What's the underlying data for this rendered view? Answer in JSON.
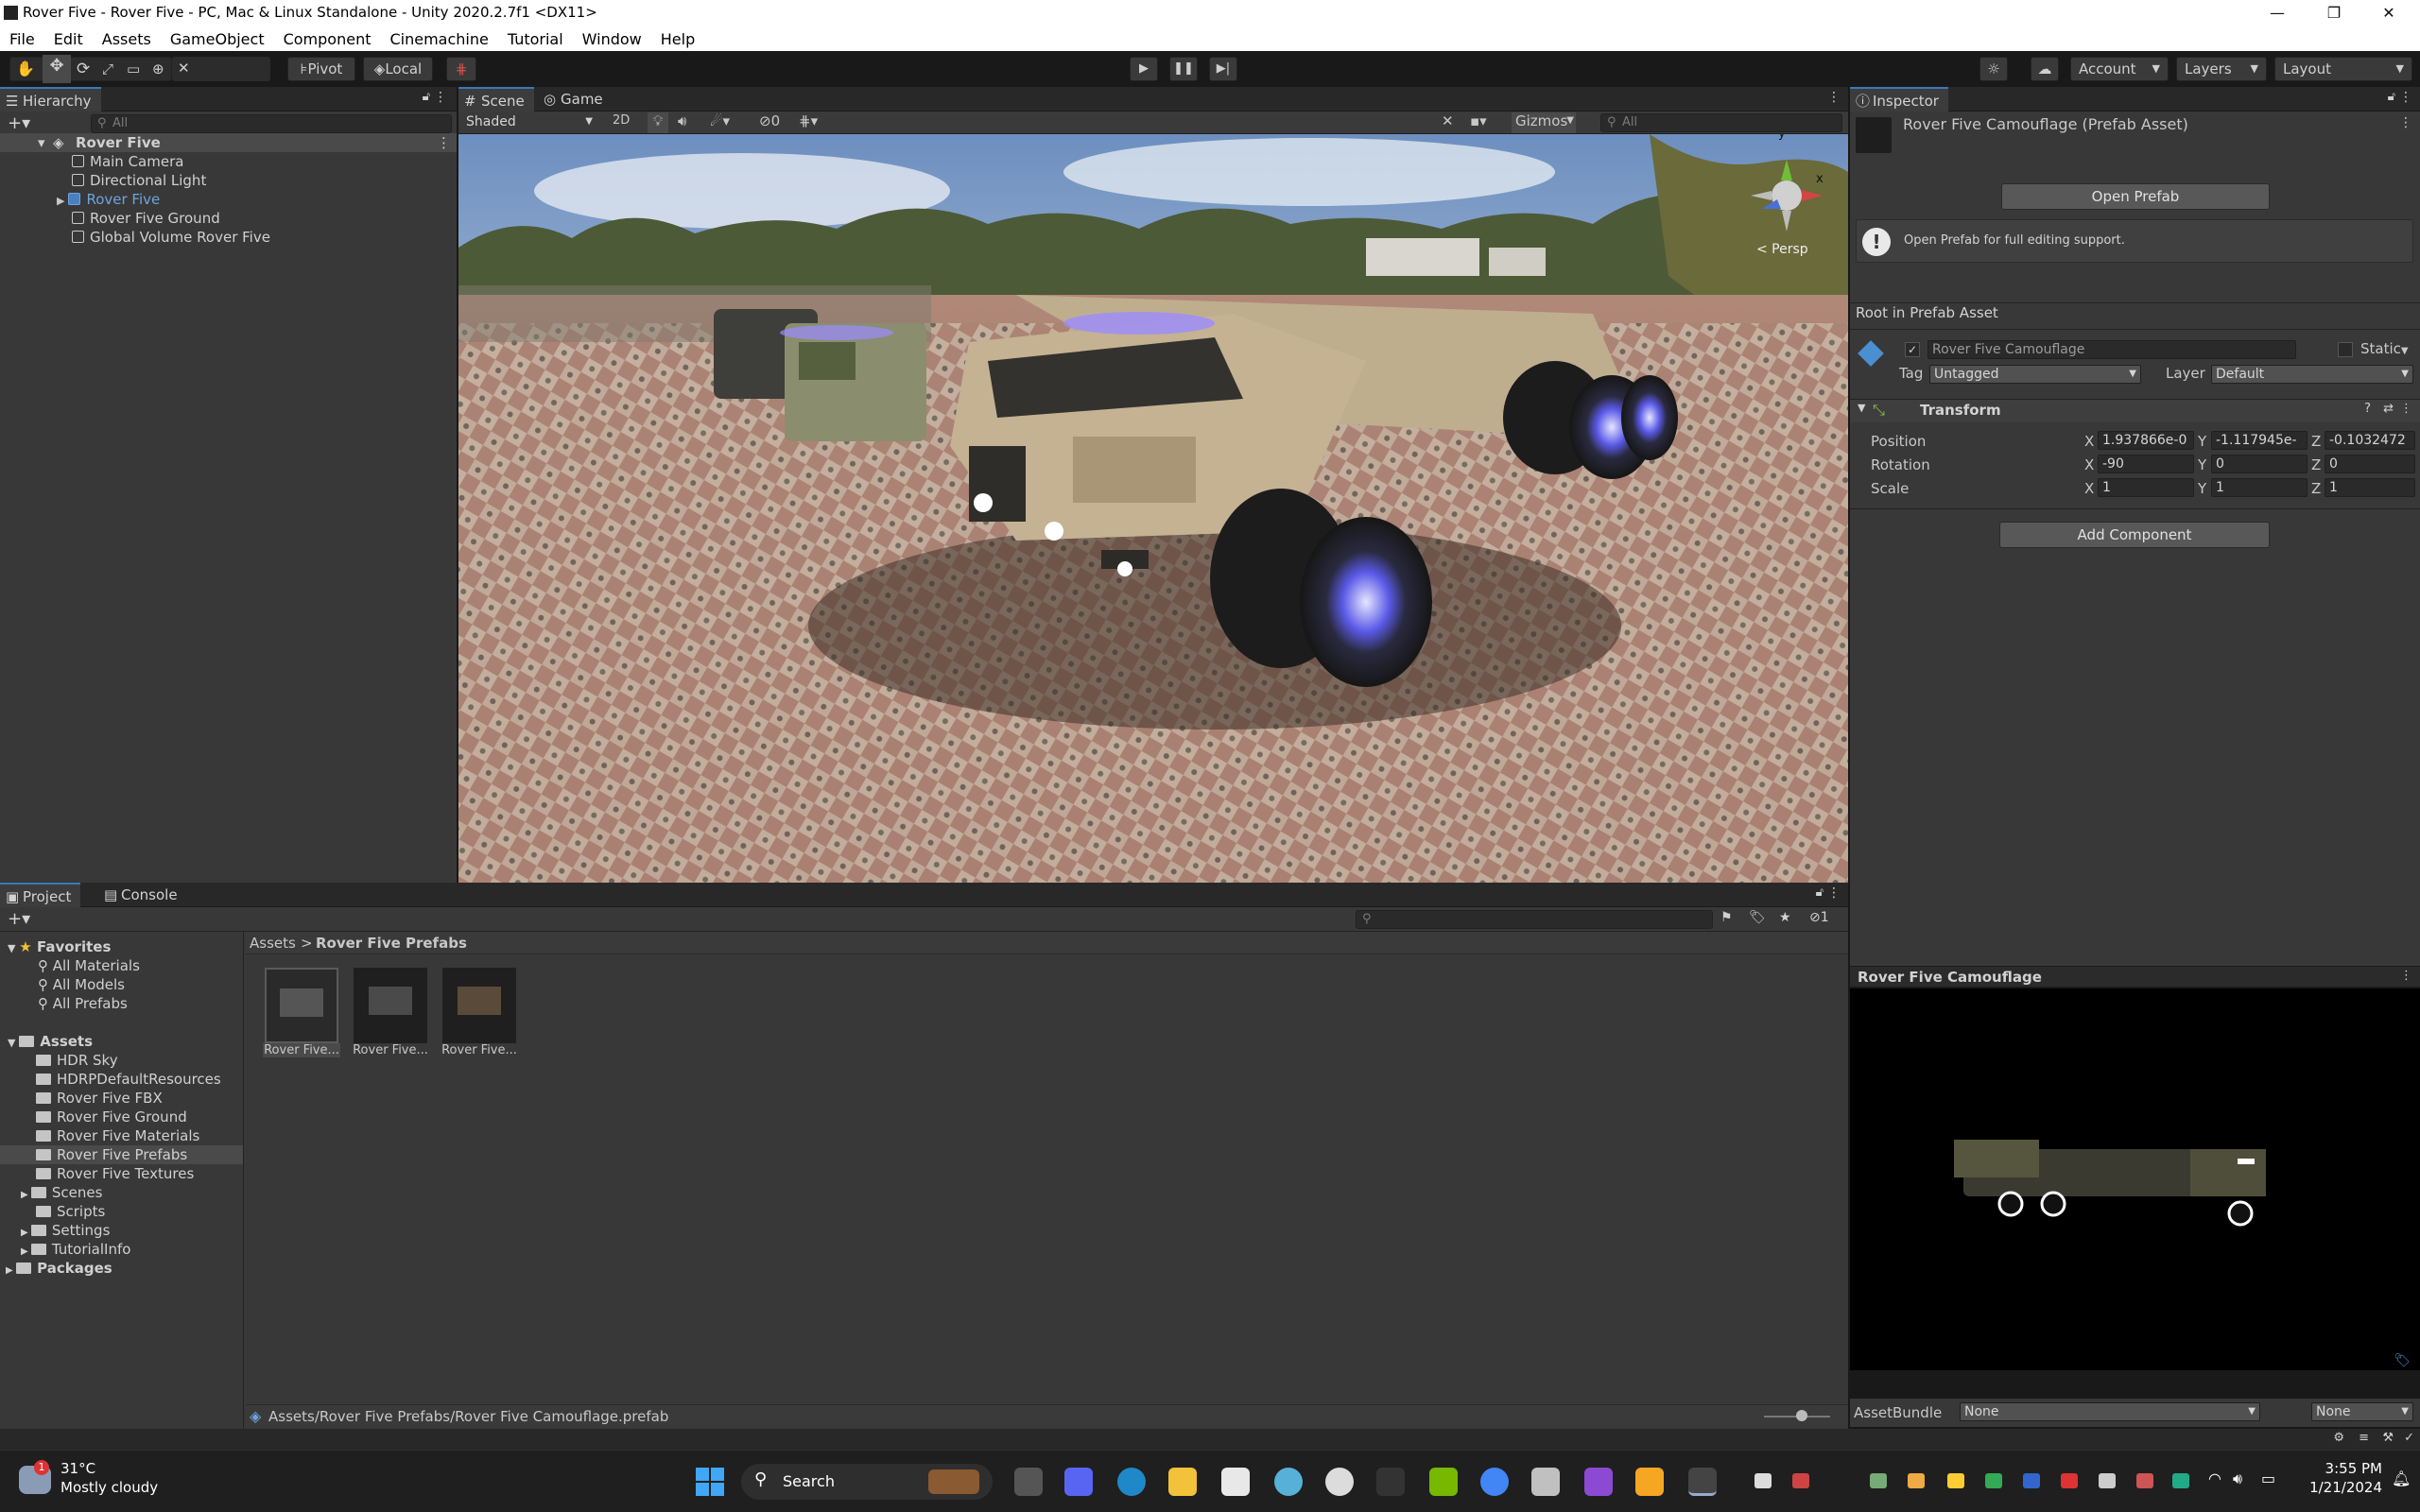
{
  "window": {
    "title": "Rover Five - Rover Five - PC, Mac & Linux Standalone - Unity 2020.2.7f1 <DX11>",
    "controls": [
      "—",
      "❐",
      "✕"
    ]
  },
  "menu": [
    "File",
    "Edit",
    "Assets",
    "GameObject",
    "Component",
    "Cinemachine",
    "Tutorial",
    "Window",
    "Help"
  ],
  "toolbar": {
    "pivot": "Pivot",
    "local": "Local",
    "account": "Account",
    "layers": "Layers",
    "layout": "Layout"
  },
  "hierarchy": {
    "tab": "Hierarchy",
    "search_placeholder": "All",
    "scene": "Rover Five",
    "items": [
      "Main Camera",
      "Directional Light",
      "Rover Five",
      "Rover Five Ground",
      "Global Volume Rover Five"
    ]
  },
  "scene_view": {
    "tabs": [
      "Scene",
      "Game"
    ],
    "shading": "Shaded",
    "mode_2d": "2D",
    "hidden_count": "0",
    "gizmos": "Gizmos",
    "search_placeholder": "All",
    "persp": "< Persp",
    "axis_y": "y",
    "axis_x": "x"
  },
  "inspector": {
    "tab": "Inspector",
    "asset_title": "Rover Five Camouflage (Prefab Asset)",
    "open_prefab": "Open Prefab",
    "info": "Open Prefab for full editing support.",
    "root_label": "Root in Prefab Asset",
    "object_name": "Rover Five Camouflage",
    "static": "Static",
    "tag_label": "Tag",
    "tag_value": "Untagged",
    "layer_label": "Layer",
    "layer_value": "Default",
    "transform": {
      "title": "Transform",
      "rows": [
        {
          "label": "Position",
          "x": "1.937866e-0",
          "y": "-1.117945e-",
          "z": "-0.1032472"
        },
        {
          "label": "Rotation",
          "x": "-90",
          "y": "0",
          "z": "0"
        },
        {
          "label": "Scale",
          "x": "1",
          "y": "1",
          "z": "1"
        }
      ]
    },
    "add_component": "Add Component"
  },
  "preview": {
    "title": "Rover Five Camouflage",
    "assetbundle_label": "AssetBundle",
    "assetbundle_value": "None",
    "variant_value": "None"
  },
  "project": {
    "tabs": [
      "Project",
      "Console"
    ],
    "favorites_label": "Favorites",
    "favorites": [
      "All Materials",
      "All Models",
      "All Prefabs"
    ],
    "assets_label": "Assets",
    "assets_folders": [
      "HDR Sky",
      "HDRPDefaultResources",
      "Rover Five FBX",
      "Rover Five Ground",
      "Rover Five Materials",
      "Rover Five Prefabs",
      "Rover Five Textures",
      "Scenes",
      "Scripts",
      "Settings",
      "TutorialInfo"
    ],
    "packages_label": "Packages",
    "breadcrumb_root": "Assets",
    "breadcrumb_sep": ">",
    "breadcrumb_current": "Rover Five Prefabs",
    "hidden_count": "1",
    "files": [
      "Rover Five...",
      "Rover Five...",
      "Rover Five..."
    ],
    "status_path": "Assets/Rover Five Prefabs/Rover Five Camouflage.prefab"
  },
  "taskbar": {
    "weather_temp": "31°C",
    "weather_desc": "Mostly cloudy",
    "notif_count": "1",
    "search": "Search",
    "time": "3:55 PM",
    "date": "1/21/2024"
  },
  "colors": {
    "accent": "#3a79bb",
    "selected_text": "#6ea3de",
    "panel": "#383838",
    "dark": "#191919"
  }
}
